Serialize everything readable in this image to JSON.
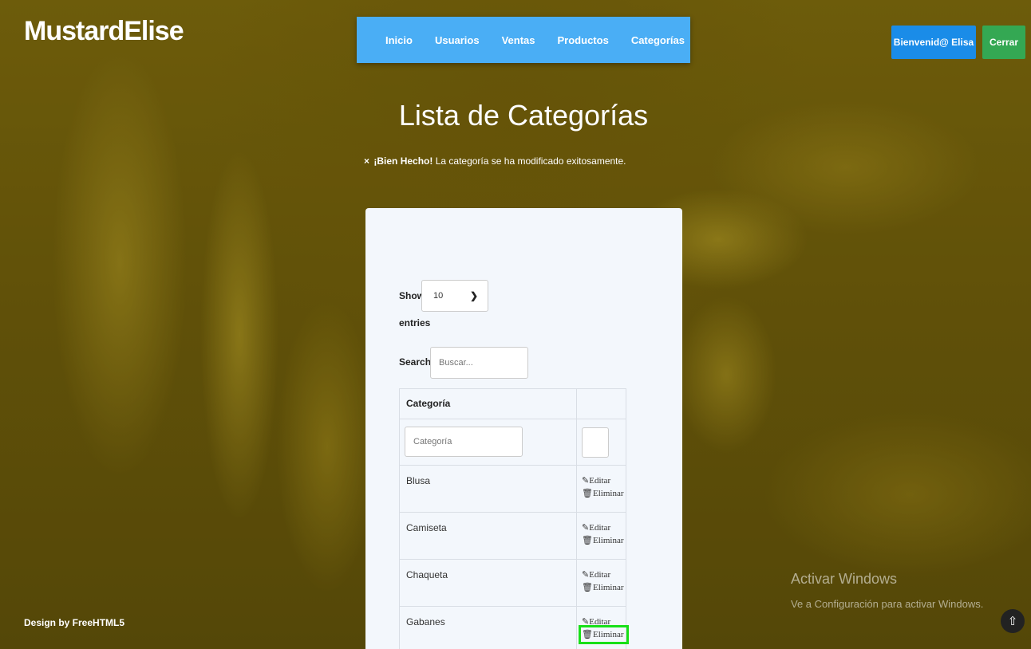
{
  "brand": "MustardElise",
  "nav": {
    "items": [
      "Inicio",
      "Usuarios",
      "Ventas",
      "Productos",
      "Categorías"
    ]
  },
  "user": {
    "welcome": "Bienvenid@ Elisa",
    "logout": "Cerrar"
  },
  "page": {
    "title": "Lista de Categorías"
  },
  "alert": {
    "close": "×",
    "strong": "¡Bien Hecho!",
    "message": " La categoría se ha modificado exitosamente."
  },
  "datatable": {
    "show_label": "Show",
    "entries_label": "entries",
    "page_size": "10",
    "search_label": "Search:",
    "search_placeholder": "Buscar...",
    "column_header": "Categoría",
    "filter_placeholder": "Categoría",
    "edit_label": "Editar",
    "delete_label": "Eliminar",
    "edit_icon": "pencil-square-icon",
    "delete_icon": "trash-icon",
    "rows": [
      {
        "name": "Blusa"
      },
      {
        "name": "Camiseta"
      },
      {
        "name": "Chaqueta"
      },
      {
        "name": "Gabanes"
      }
    ]
  },
  "footer": {
    "credit": "Design by FreeHTML5"
  },
  "windows_watermark": {
    "title": "Activar Windows",
    "subtitle": "Ve a Configuración para activar Windows."
  },
  "colors": {
    "nav": "#4aaef5",
    "welcome_button": "#1a8ce8",
    "logout_button": "#34a853",
    "highlight": "#18e018"
  }
}
